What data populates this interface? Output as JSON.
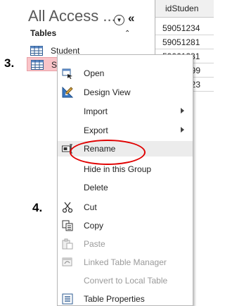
{
  "nav": {
    "title": "All Access ...",
    "group_label": "Tables",
    "items": [
      {
        "label": "Student"
      },
      {
        "label": "S"
      }
    ]
  },
  "steps": {
    "step3": "3.",
    "step4": "4."
  },
  "sheet": {
    "header": "idStuden",
    "values": [
      "59051234",
      "59051281",
      "59061281",
      "599",
      "123"
    ]
  },
  "menu": {
    "items": [
      {
        "label": "Open",
        "icon": "open-icon"
      },
      {
        "label": "Design View",
        "icon": "design-view-icon"
      },
      {
        "label": "Import",
        "icon": "",
        "submenu": true
      },
      {
        "label": "Export",
        "icon": "",
        "submenu": true
      },
      {
        "label": "Rename",
        "icon": "rename-icon"
      },
      {
        "label": "Hide in this Group",
        "icon": ""
      },
      {
        "label": "Delete",
        "icon": ""
      },
      {
        "label": "Cut",
        "icon": "cut-icon"
      },
      {
        "label": "Copy",
        "icon": "copy-icon"
      },
      {
        "label": "Paste",
        "icon": "paste-icon",
        "disabled": true
      },
      {
        "label": "Linked Table Manager",
        "icon": "linked-table-icon",
        "disabled": true
      },
      {
        "label": "Convert to Local Table",
        "icon": "",
        "disabled": true
      },
      {
        "label": "Table Properties",
        "icon": "table-properties-icon"
      }
    ]
  },
  "colors": {
    "selection": "#f9c4c8",
    "highlight_circle": "#e00000"
  }
}
